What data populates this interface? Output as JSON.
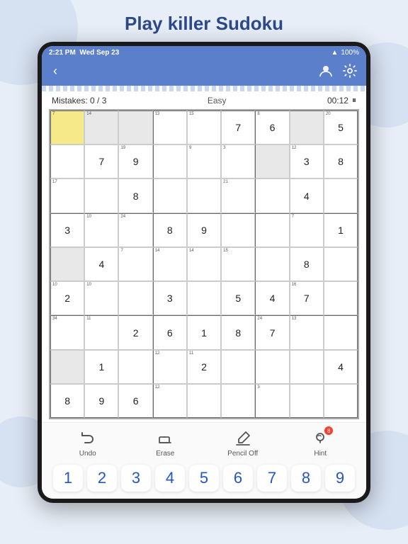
{
  "page": {
    "title": "Play killer Sudoku",
    "bg_color": "#e8eef7",
    "accent_color": "#5b7fcb"
  },
  "status_bar": {
    "time": "2:21 PM",
    "date": "Wed Sep 23",
    "wifi": "100%"
  },
  "game": {
    "mistakes_label": "Mistakes: 0 / 3",
    "difficulty": "Easy",
    "timer": "00:12"
  },
  "toolbar": {
    "items": [
      {
        "id": "undo",
        "label": "Undo",
        "icon": "↩"
      },
      {
        "id": "erase",
        "label": "Erase",
        "icon": "✏"
      },
      {
        "id": "pencil",
        "label": "Pencil Off",
        "icon": "✏"
      },
      {
        "id": "hint",
        "label": "Hint",
        "icon": "💡",
        "badge": "8"
      }
    ]
  },
  "number_pad": {
    "numbers": [
      "1",
      "2",
      "3",
      "4",
      "5",
      "6",
      "7",
      "8",
      "9"
    ]
  },
  "grid": {
    "cells": [
      {
        "row": 0,
        "col": 0,
        "value": "",
        "corner": "7",
        "highlight": true
      },
      {
        "row": 0,
        "col": 1,
        "value": "",
        "corner": "14",
        "gray": true
      },
      {
        "row": 0,
        "col": 2,
        "value": "",
        "corner": "",
        "gray": true
      },
      {
        "row": 0,
        "col": 3,
        "value": "",
        "corner": "13",
        "gray": false
      },
      {
        "row": 0,
        "col": 4,
        "value": "",
        "corner": "15"
      },
      {
        "row": 0,
        "col": 5,
        "value": "7",
        "corner": ""
      },
      {
        "row": 0,
        "col": 6,
        "value": "6",
        "corner": "8"
      },
      {
        "row": 0,
        "col": 7,
        "value": "",
        "corner": "",
        "gray": true
      },
      {
        "row": 0,
        "col": 8,
        "value": "5",
        "corner": "20"
      },
      {
        "row": 1,
        "col": 0,
        "value": "",
        "corner": ""
      },
      {
        "row": 1,
        "col": 1,
        "value": "7",
        "corner": ""
      },
      {
        "row": 1,
        "col": 2,
        "value": "9",
        "corner": "19"
      },
      {
        "row": 1,
        "col": 3,
        "value": "",
        "corner": ""
      },
      {
        "row": 1,
        "col": 4,
        "value": "",
        "corner": "9"
      },
      {
        "row": 1,
        "col": 5,
        "value": "",
        "corner": "3"
      },
      {
        "row": 1,
        "col": 6,
        "value": "",
        "corner": "",
        "gray": true
      },
      {
        "row": 1,
        "col": 7,
        "value": "3",
        "corner": "12"
      },
      {
        "row": 1,
        "col": 8,
        "value": "8",
        "corner": ""
      },
      {
        "row": 2,
        "col": 0,
        "value": "",
        "corner": "17"
      },
      {
        "row": 2,
        "col": 1,
        "value": "",
        "corner": ""
      },
      {
        "row": 2,
        "col": 2,
        "value": "8",
        "corner": ""
      },
      {
        "row": 2,
        "col": 3,
        "value": "",
        "corner": ""
      },
      {
        "row": 2,
        "col": 4,
        "value": "",
        "corner": ""
      },
      {
        "row": 2,
        "col": 5,
        "value": "",
        "corner": "21"
      },
      {
        "row": 2,
        "col": 6,
        "value": "",
        "corner": ""
      },
      {
        "row": 2,
        "col": 7,
        "value": "4",
        "corner": ""
      },
      {
        "row": 2,
        "col": 8,
        "value": "",
        "corner": ""
      },
      {
        "row": 3,
        "col": 0,
        "value": "3",
        "corner": ""
      },
      {
        "row": 3,
        "col": 1,
        "value": "",
        "corner": "10"
      },
      {
        "row": 3,
        "col": 2,
        "value": "",
        "corner": "24"
      },
      {
        "row": 3,
        "col": 3,
        "value": "8",
        "corner": ""
      },
      {
        "row": 3,
        "col": 4,
        "value": "9",
        "corner": ""
      },
      {
        "row": 3,
        "col": 5,
        "value": "",
        "corner": ""
      },
      {
        "row": 3,
        "col": 6,
        "value": "",
        "corner": ""
      },
      {
        "row": 3,
        "col": 7,
        "value": "",
        "corner": "7"
      },
      {
        "row": 3,
        "col": 8,
        "value": "1",
        "corner": ""
      },
      {
        "row": 4,
        "col": 0,
        "value": "",
        "corner": "",
        "gray": true
      },
      {
        "row": 4,
        "col": 1,
        "value": "4",
        "corner": ""
      },
      {
        "row": 4,
        "col": 2,
        "value": "",
        "corner": "7"
      },
      {
        "row": 4,
        "col": 3,
        "value": "",
        "corner": "14"
      },
      {
        "row": 4,
        "col": 4,
        "value": "",
        "corner": "14"
      },
      {
        "row": 4,
        "col": 5,
        "value": "",
        "corner": "15"
      },
      {
        "row": 4,
        "col": 6,
        "value": "",
        "corner": ""
      },
      {
        "row": 4,
        "col": 7,
        "value": "8",
        "corner": ""
      },
      {
        "row": 4,
        "col": 8,
        "value": "",
        "corner": ""
      },
      {
        "row": 5,
        "col": 0,
        "value": "2",
        "corner": "10"
      },
      {
        "row": 5,
        "col": 1,
        "value": "",
        "corner": "10"
      },
      {
        "row": 5,
        "col": 2,
        "value": "",
        "corner": ""
      },
      {
        "row": 5,
        "col": 3,
        "value": "3",
        "corner": ""
      },
      {
        "row": 5,
        "col": 4,
        "value": "",
        "corner": ""
      },
      {
        "row": 5,
        "col": 5,
        "value": "5",
        "corner": ""
      },
      {
        "row": 5,
        "col": 6,
        "value": "4",
        "corner": ""
      },
      {
        "row": 5,
        "col": 7,
        "value": "7",
        "corner": "16"
      },
      {
        "row": 5,
        "col": 8,
        "value": "",
        "corner": ""
      },
      {
        "row": 6,
        "col": 0,
        "value": "",
        "corner": "34"
      },
      {
        "row": 6,
        "col": 1,
        "value": "",
        "corner": "11"
      },
      {
        "row": 6,
        "col": 2,
        "value": "2",
        "corner": ""
      },
      {
        "row": 6,
        "col": 3,
        "value": "6",
        "corner": ""
      },
      {
        "row": 6,
        "col": 4,
        "value": "1",
        "corner": ""
      },
      {
        "row": 6,
        "col": 5,
        "value": "8",
        "corner": ""
      },
      {
        "row": 6,
        "col": 6,
        "value": "7",
        "corner": "24"
      },
      {
        "row": 6,
        "col": 7,
        "value": "",
        "corner": "13"
      },
      {
        "row": 6,
        "col": 8,
        "value": ""
      },
      {
        "row": 7,
        "col": 0,
        "value": "",
        "corner": "",
        "gray": true
      },
      {
        "row": 7,
        "col": 1,
        "value": "1",
        "corner": ""
      },
      {
        "row": 7,
        "col": 2,
        "value": "",
        "corner": ""
      },
      {
        "row": 7,
        "col": 3,
        "value": "",
        "corner": "12"
      },
      {
        "row": 7,
        "col": 4,
        "value": "2",
        "corner": "11"
      },
      {
        "row": 7,
        "col": 5,
        "value": "",
        "corner": ""
      },
      {
        "row": 7,
        "col": 6,
        "value": "",
        "corner": ""
      },
      {
        "row": 7,
        "col": 7,
        "value": "",
        "corner": ""
      },
      {
        "row": 7,
        "col": 8,
        "value": "4",
        "corner": ""
      },
      {
        "row": 8,
        "col": 0,
        "value": "8",
        "corner": ""
      },
      {
        "row": 8,
        "col": 1,
        "value": "9",
        "corner": ""
      },
      {
        "row": 8,
        "col": 2,
        "value": "6",
        "corner": ""
      },
      {
        "row": 8,
        "col": 3,
        "value": "",
        "corner": "12"
      },
      {
        "row": 8,
        "col": 4,
        "value": "",
        "corner": ""
      },
      {
        "row": 8,
        "col": 5,
        "value": "",
        "corner": ""
      },
      {
        "row": 8,
        "col": 6,
        "value": "",
        "corner": "3"
      },
      {
        "row": 8,
        "col": 7,
        "value": "",
        "corner": ""
      },
      {
        "row": 8,
        "col": 8,
        "value": ""
      }
    ]
  }
}
